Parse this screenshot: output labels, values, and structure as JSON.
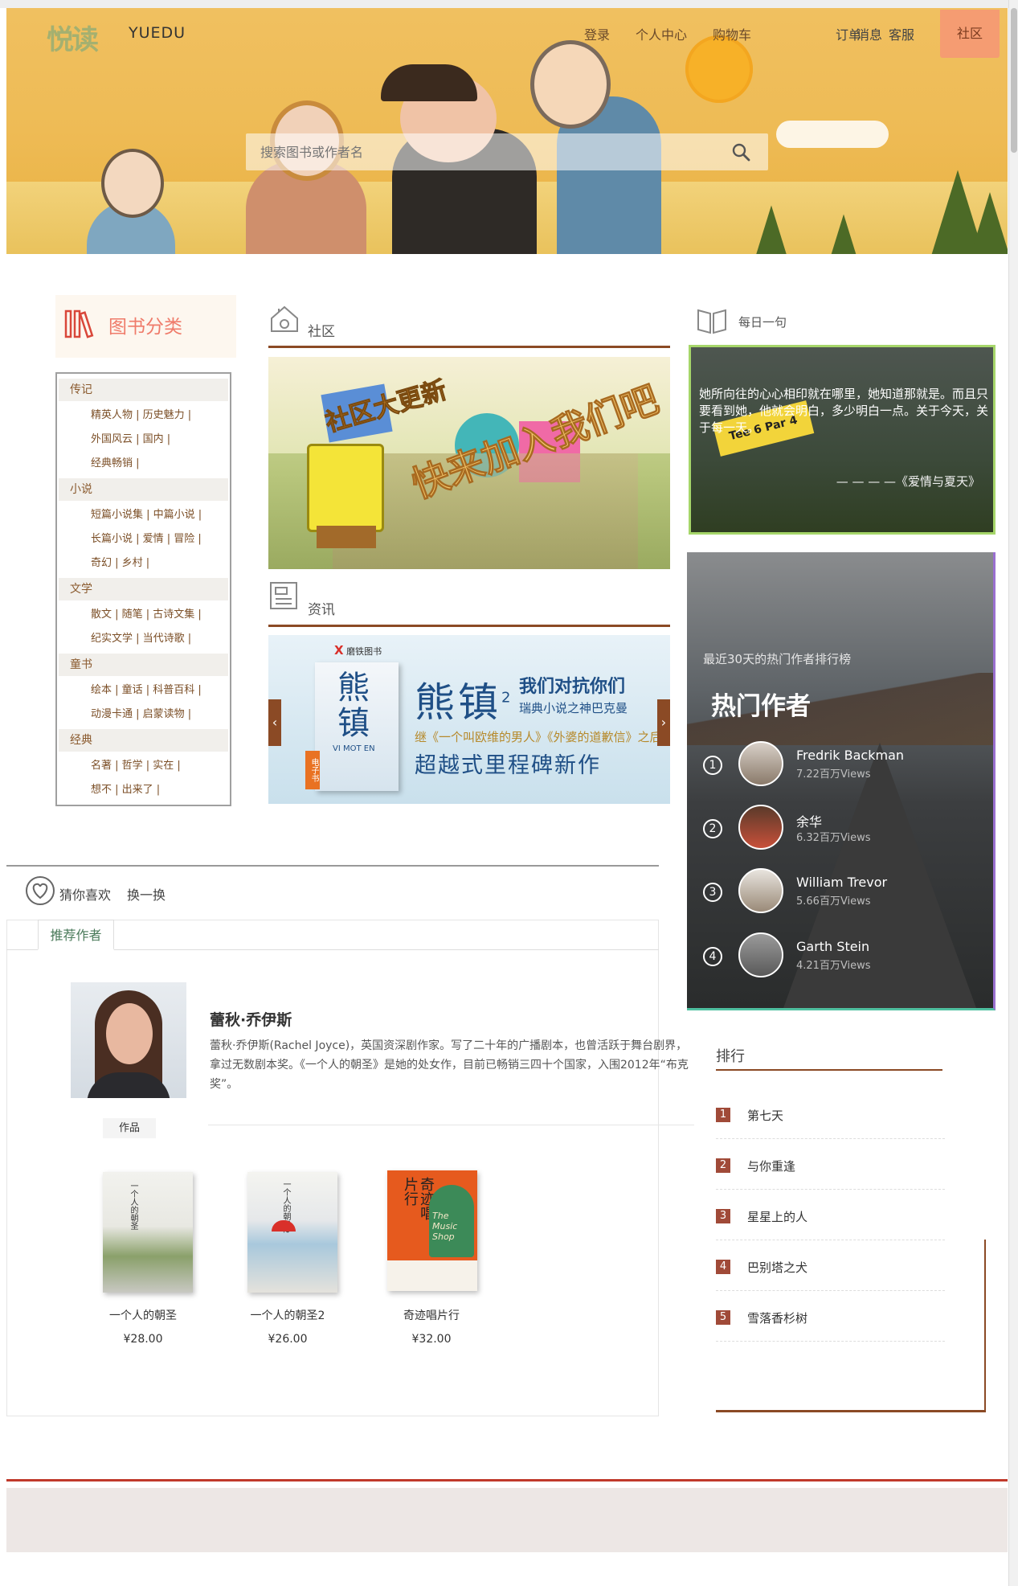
{
  "header": {
    "logo_text": "悦读",
    "brand": "YUEDU",
    "nav": [
      "登录",
      "个人中心",
      "购物车"
    ],
    "right_nav": [
      "订单",
      "消息",
      "客服"
    ],
    "community_btn": "社区",
    "search_placeholder": "搜索图书或作者名"
  },
  "categories": {
    "title": "图书分类",
    "groups": [
      {
        "name": "传记",
        "rows": [
          "精英人物 | 历史魅力 |",
          "外国风云 | 国内 |",
          "经典畅销 |"
        ]
      },
      {
        "name": "小说",
        "rows": [
          "短篇小说集 | 中篇小说 |",
          "长篇小说 | 爱情 | 冒险 |",
          "奇幻 | 乡村 |"
        ]
      },
      {
        "name": "文学",
        "rows": [
          "散文 | 随笔 | 古诗文集 |",
          "纪实文学 | 当代诗歌 |"
        ]
      },
      {
        "name": "童书",
        "rows": [
          "绘本 | 童话 | 科普百科 |",
          "动漫卡通 | 启蒙读物 |"
        ]
      },
      {
        "name": "经典",
        "rows": [
          "名著 | 哲学 | 实在 |",
          "想不 | 出来了 |"
        ]
      }
    ]
  },
  "community": {
    "title": "社区",
    "banner_text_1": "社区大更新",
    "banner_text_2": "快来加入我们吧"
  },
  "news": {
    "title": "资讯",
    "publisher": "磨铁图书",
    "book_title": "熊镇",
    "book_title_sup": "2",
    "book_subtitle_latin": "VI MOT EN",
    "headline_1": "我们对抗你们",
    "headline_2": "瑞典小说之神巴克曼",
    "tagline_1": "继《一个叫欧维的男人》《外婆的道歉信》之后",
    "tagline_2": "超越式里程碑新作",
    "ebook_tag": "电子书",
    "prev": "‹",
    "next": "›"
  },
  "daily": {
    "title": "每日一句",
    "quote": "她所向往的心心相印就在哪里，她知道那就是。而且只要看到她，他就会明白，多少明白一点。关于今天，关于每一天。",
    "source": "— — — —《爱情与夏天》",
    "sign_text": "Tee 6 Par 4"
  },
  "hot_authors": {
    "subtitle": "最近30天的热门作者排行榜",
    "title": "热门作者",
    "items": [
      {
        "rank": "1",
        "name": "Fredrik Backman",
        "views": "7.22百万Views"
      },
      {
        "rank": "2",
        "name": "余华",
        "views": "6.32百万Views"
      },
      {
        "rank": "3",
        "name": "William Trevor",
        "views": "5.66百万Views"
      },
      {
        "rank": "4",
        "name": "Garth Stein",
        "views": "4.21百万Views"
      }
    ]
  },
  "ranking": {
    "title": "排行",
    "items": [
      {
        "n": "1",
        "title": "第七天"
      },
      {
        "n": "2",
        "title": "与你重逢"
      },
      {
        "n": "3",
        "title": "星星上的人"
      },
      {
        "n": "4",
        "title": "巴别塔之犬"
      },
      {
        "n": "5",
        "title": "雪落香杉树"
      }
    ]
  },
  "guess": {
    "title": "猜你喜欢",
    "refresh": "换一换",
    "tab": "推荐作者",
    "author_name": "蕾秋·乔伊斯",
    "author_bio": "蕾秋·乔伊斯(Rachel Joyce)，英国资深剧作家。写了二十年的广播剧本，也曾活跃于舞台剧界，拿过无数剧本奖。《一个人的朝圣》是她的处女作，目前已畅销三四十个国家，入围2012年“布克奖”。",
    "works_label": "作品",
    "books": [
      {
        "title": "一个人的朝圣",
        "price": "¥28.00",
        "cover_title": "一个人的朝圣"
      },
      {
        "title": "一个人的朝圣2",
        "price": "¥26.00",
        "cover_title": "一个人的朝圣2"
      },
      {
        "title": "奇迹唱片行",
        "price": "¥32.00",
        "cover_title": "奇迹唱片行",
        "cover_latin": "The Music Shop"
      }
    ]
  },
  "colors": {
    "accent": "#8b4a25",
    "community_btn": "#f59c72",
    "category_title": "#ef7b6a",
    "rank_badge": "#a04a38"
  }
}
